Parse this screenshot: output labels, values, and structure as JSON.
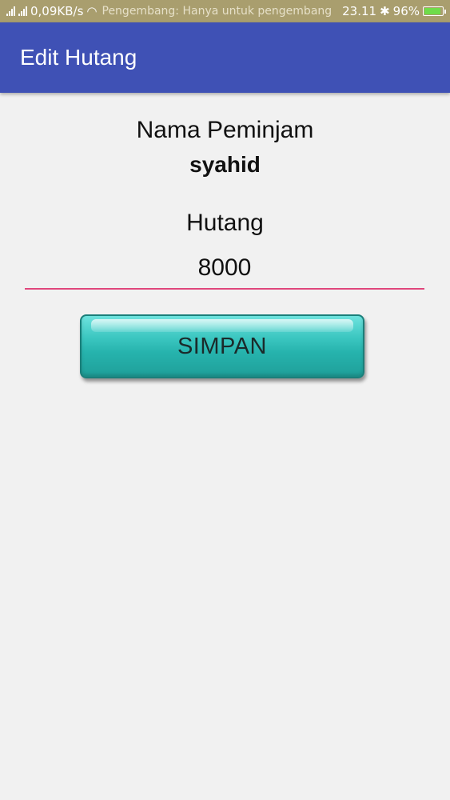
{
  "status_bar": {
    "data_speed": "0,09KB/s",
    "notice": "Pengembang: Hanya untuk pengembang",
    "time": "23.11",
    "battery_percent": "96%",
    "battery_level": 0.96,
    "battery_color": "#6fdc4a"
  },
  "app_bar": {
    "title": "Edit Hutang",
    "color": "#3f51b5"
  },
  "form": {
    "borrower_label": "Nama Peminjam",
    "borrower_name": "syahid",
    "debt_label": "Hutang",
    "debt_value": "8000",
    "accent_color": "#e0467c"
  },
  "actions": {
    "save_label": "SIMPAN"
  }
}
